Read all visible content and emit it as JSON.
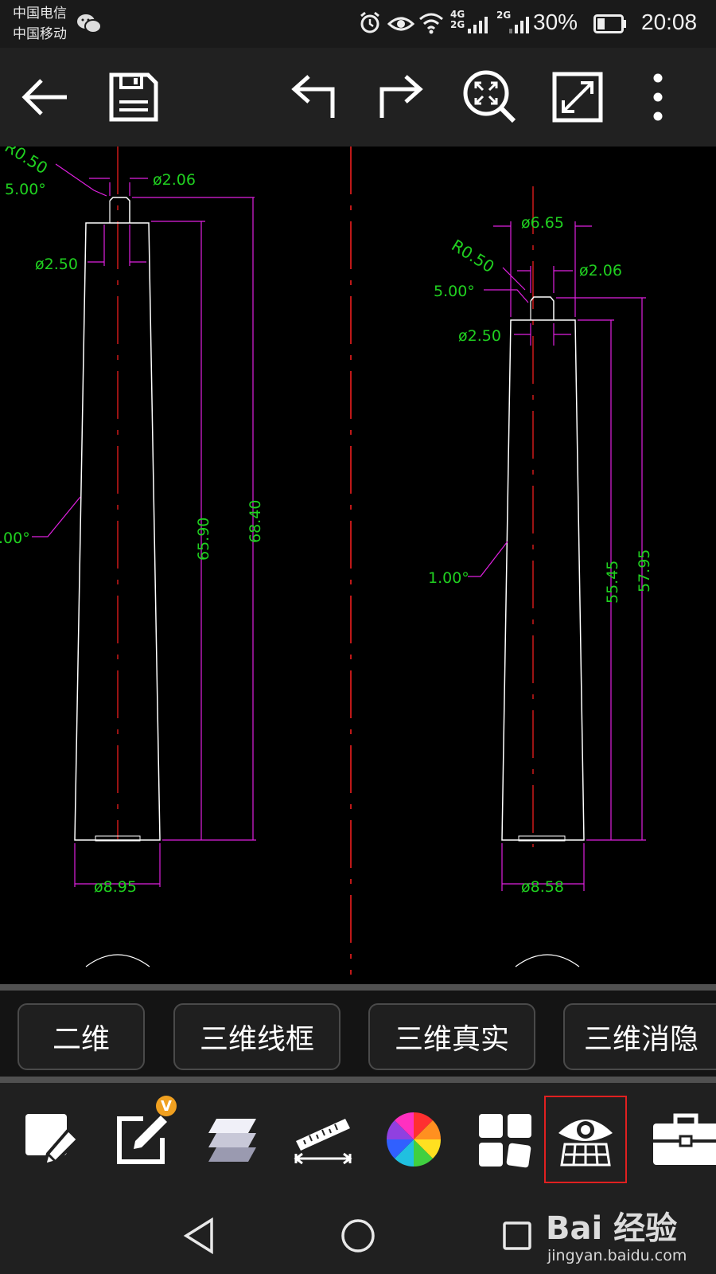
{
  "status_bar": {
    "carrier_1": "中国电信",
    "carrier_2": "中国移动",
    "network_1": "4G",
    "network_2": "2G",
    "network_3": "2G",
    "battery": "30%",
    "time": "20:08"
  },
  "toolbar": {
    "icons": [
      "back-arrow-icon",
      "save-icon",
      "undo-icon",
      "redo-icon",
      "zoom-extents-icon",
      "fullscreen-icon",
      "more-icon"
    ]
  },
  "drawing": {
    "left_part": {
      "top_radius": "R0.50",
      "top_angle": "5.00°",
      "tip_diameter": "ø2.06",
      "hole_diameter": "ø2.50",
      "taper_angle": ".00°",
      "inner_height": "65.90",
      "total_height": "68.40",
      "base_diameter": "ø8.95"
    },
    "right_part": {
      "top_diameter": "ø6.65",
      "top_radius": "R0.50",
      "tip_diameter": "ø2.06",
      "top_angle": "5.00°",
      "hole_diameter": "ø2.50",
      "taper_angle": "1.00°",
      "inner_height": "55.45",
      "total_height": "57.95",
      "base_diameter": "ø8.58"
    },
    "colors": {
      "outline": "#ffffff",
      "centerline": "#ff2020",
      "dimension": "#e020e0",
      "text": "#20d020"
    }
  },
  "view_modes": {
    "mode_2d": "二维",
    "mode_3d_wire": "三维线框",
    "mode_3d_real": "三维真实",
    "mode_3d_hidden": "三维消隐"
  },
  "tools": {
    "badge": "V",
    "selected_index": 6,
    "icons": [
      "draw-icon",
      "edit-icon",
      "layers-icon",
      "measure-icon",
      "color-wheel-icon",
      "layout-icon",
      "view-mode-icon",
      "toolbox-icon"
    ]
  },
  "watermark": {
    "logo": "Bai 经验",
    "url": "jingyan.baidu.com"
  }
}
